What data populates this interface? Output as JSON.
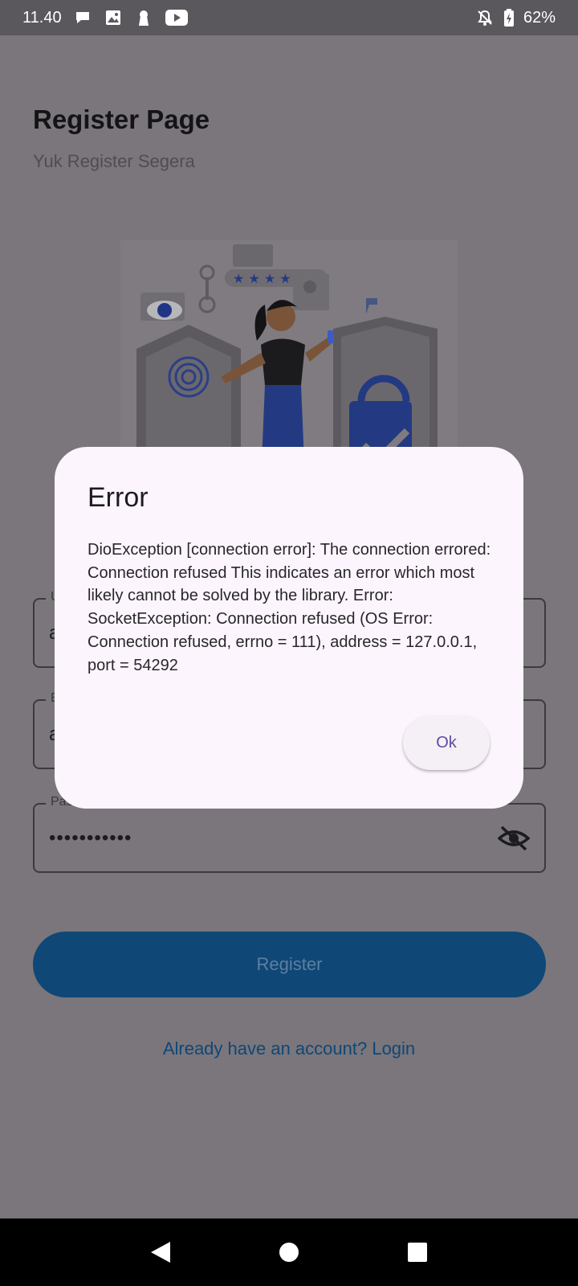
{
  "status_bar": {
    "time": "11.40",
    "battery": "62%",
    "left_icons": [
      "chat-bubble-icon",
      "photo-icon",
      "keyhole-icon",
      "youtube-icon"
    ],
    "right_icons": [
      "bell-off-icon",
      "battery-charging-icon"
    ]
  },
  "page": {
    "title": "Register Page",
    "subtitle": "Yuk Register Segera",
    "fields": [
      {
        "label": "U",
        "value": "a"
      },
      {
        "label": "E",
        "value": "a"
      },
      {
        "label": "Password",
        "value": "•••••••••••"
      }
    ],
    "register_label": "Register",
    "login_link": "Already have an account? Login"
  },
  "dialog": {
    "title": "Error",
    "message": "DioException [connection error]: The connection errored: Connection refused This indicates an error which most likely cannot be solved by the library. Error: SocketException: Connection refused (OS Error: Connection refused, errno = 111), address = 127.0.0.1, port = 54292",
    "ok_label": "Ok"
  },
  "colors": {
    "scrim_background": "#7a767b",
    "dialog_background": "#fcf5fd",
    "primary": "#0f4777",
    "dialog_button_text": "#5b4ba1"
  },
  "nav_bar": {
    "buttons": [
      "back-icon",
      "home-icon",
      "recents-icon"
    ]
  }
}
